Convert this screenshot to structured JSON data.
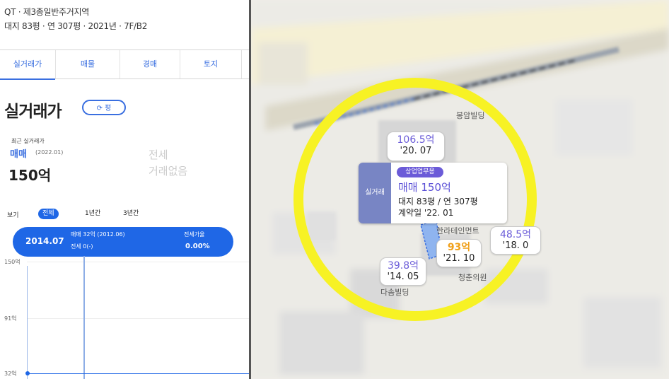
{
  "header": {
    "subtitle_line1": "QT · 제3종일반주거지역",
    "subtitle_line2": "대지 83평 · 연 307평 · 2021년 · 7F/B2"
  },
  "tabs": [
    {
      "label": "실거래가"
    },
    {
      "label": "매물"
    },
    {
      "label": "경매"
    },
    {
      "label": "토지"
    }
  ],
  "section": {
    "title": "실거래가",
    "refresh_button": "⟳ 평"
  },
  "recent": {
    "label": "최근 실거래가",
    "type": "매매",
    "date": "(2022.01)",
    "price": "150억",
    "jeonse_label": "전세",
    "jeonse_value": "거래없음"
  },
  "period": {
    "label": "보기",
    "options": [
      "전체",
      "1년간",
      "3년간"
    ],
    "selected": "전체"
  },
  "summary": {
    "date": "2014.07",
    "sale": "매매 32억 (2012.06)",
    "jeonse": "전세 0(-)",
    "ratio_label": "전세가율",
    "ratio_value": "0.00%"
  },
  "chart_data": {
    "type": "line",
    "y_ticks": [
      "150억",
      "91억",
      "32억"
    ],
    "ylim": [
      32,
      150
    ]
  },
  "map": {
    "popup": {
      "side_label": "실거래",
      "badge": "상업업무용",
      "title": "매매 150억",
      "line1": "대지 83평 / 연 307평",
      "line2": "계약일 '22. 01"
    },
    "price_labels": [
      {
        "price": "106.5억",
        "date": "'20. 07"
      },
      {
        "price": "93억",
        "date": "'21. 10"
      },
      {
        "price": "39.8억",
        "date": "'14. 05"
      },
      {
        "price": "48.5억",
        "date": "'18. 0"
      }
    ],
    "place_names": [
      "봉암빌딩",
      "한라테인먼트",
      "청춘의원",
      "다솜빌딩"
    ]
  }
}
